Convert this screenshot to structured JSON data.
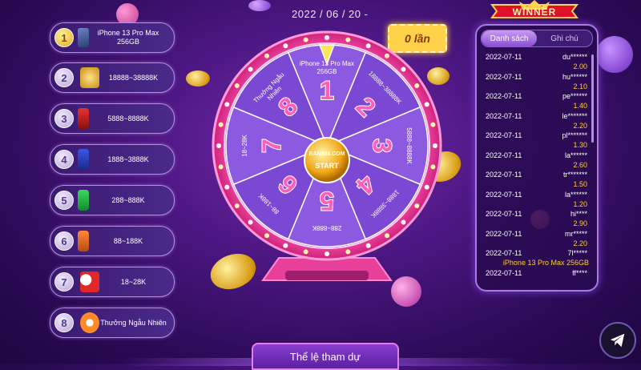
{
  "date": "2022 / 06 / 20 -",
  "turns": "0 lần",
  "prizes": [
    {
      "num": "1",
      "label": "iPhone 13 Pro Max\n256GB",
      "icon": "phone-icon"
    },
    {
      "num": "2",
      "label": "18888~38888K",
      "icon": "gold-stack-icon"
    },
    {
      "num": "3",
      "label": "5888~8888K",
      "icon": "red-chips-icon"
    },
    {
      "num": "4",
      "label": "1888~3888K",
      "icon": "blue-chips-icon"
    },
    {
      "num": "5",
      "label": "288~888K",
      "icon": "green-chips-icon"
    },
    {
      "num": "6",
      "label": "88~188K",
      "icon": "orange-chips-icon"
    },
    {
      "num": "7",
      "label": "18~28K",
      "icon": "dice-icon"
    },
    {
      "num": "8",
      "label": "Thưởng Ngẫu Nhiên",
      "icon": "casino-chip-icon"
    }
  ],
  "wheel": {
    "segments": [
      {
        "num": "1",
        "label": "iPhone 13 Pro Max\n256GB"
      },
      {
        "num": "2",
        "label": "18888~38888K"
      },
      {
        "num": "3",
        "label": "5888~8888K"
      },
      {
        "num": "4",
        "label": "1888~3888K"
      },
      {
        "num": "5",
        "label": "288~888K"
      },
      {
        "num": "6",
        "label": "88~188K"
      },
      {
        "num": "7",
        "label": "18~28K"
      },
      {
        "num": "8",
        "label": "Thưởng Ngẫu\nNhiên"
      }
    ],
    "logo": "BAN888.COM",
    "start_label": "START"
  },
  "winner_banner": "WINNER",
  "tabs": [
    {
      "label": "Danh sách",
      "active": true
    },
    {
      "label": "Ghi chú",
      "active": false
    }
  ],
  "winners": [
    {
      "date": "2022-07-11",
      "user": "du******",
      "value": "2.00"
    },
    {
      "date": "2022-07-11",
      "user": "hu******",
      "value": "2.10"
    },
    {
      "date": "2022-07-11",
      "user": "pe******",
      "value": "1.40"
    },
    {
      "date": "2022-07-11",
      "user": "le*******",
      "value": "2.20"
    },
    {
      "date": "2022-07-11",
      "user": "pl*******",
      "value": "1.30"
    },
    {
      "date": "2022-07-11",
      "user": "la******",
      "value": "2.60"
    },
    {
      "date": "2022-07-11",
      "user": "tr*******",
      "value": "1.50"
    },
    {
      "date": "2022-07-11",
      "user": "la******",
      "value": "1.20"
    },
    {
      "date": "2022-07-11",
      "user": "hi****",
      "value": "2.90"
    },
    {
      "date": "2022-07-11",
      "user": "mr*****",
      "value": "2.20"
    },
    {
      "date": "2022-07-11",
      "user": "7l*****",
      "value": "iPhone 13 Pro Max 256GB"
    },
    {
      "date": "2022-07-11",
      "user": "ff****",
      "value": ""
    }
  ],
  "rules_label": "Thể lệ tham dự",
  "colors": {
    "accent": "#ff4fb0",
    "gold": "#ffcf33",
    "purple_bg": "#4a1680"
  }
}
